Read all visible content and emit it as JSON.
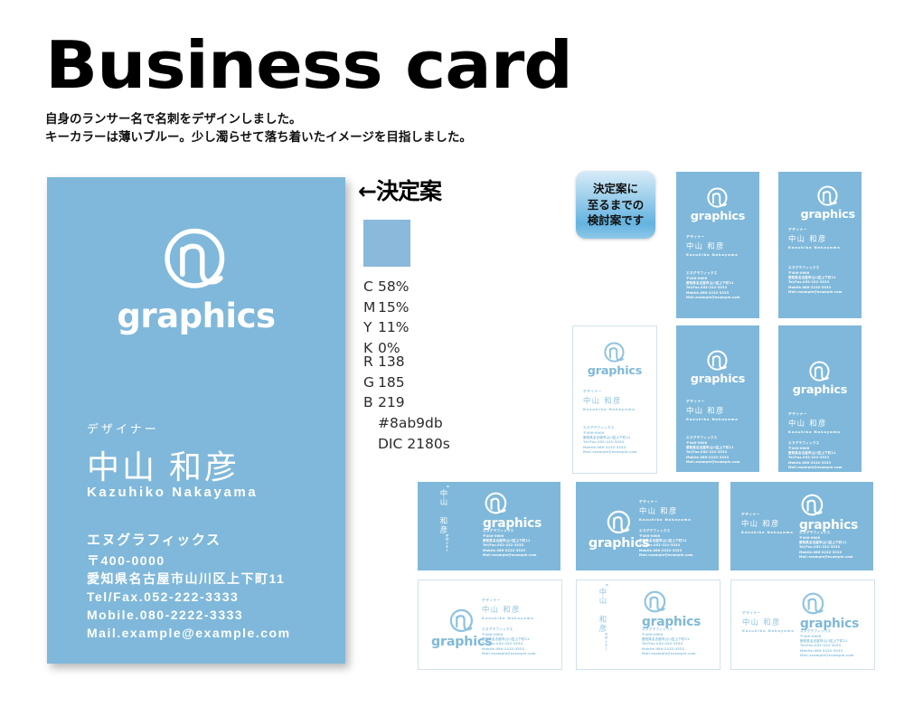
{
  "header": {
    "title": "Business card",
    "subtitle_line1": "自身のランサー名で名刺をデザインしました。",
    "subtitle_line2": "キーカラーは薄いブルー。少し濁らせて落ち着いたイメージを目指しました。"
  },
  "brand": {
    "mark": "circle-n-logo",
    "wordmark": "graphics",
    "key_color": "#8ab9db",
    "card_blue": "#7fb8da",
    "text_blue": "#8fc3de"
  },
  "card": {
    "role": "デザイナー",
    "name": "中山 和彦",
    "romaji": "Kazuhiko Nakayama",
    "company": "エヌグラフィックス",
    "postal": "〒400-0000",
    "address": "愛知県名古屋市山川区上下町11",
    "tel": "Tel/Fax.052-222-3333",
    "mobile": "Mobile.080-2222-3333",
    "mail": "Mail.example@example.com"
  },
  "decision": {
    "heading": "←決定案",
    "arrow_icon": "left-arrow-icon",
    "swatch_color": "#8ab9db",
    "cmyk": [
      {
        "key": "C",
        "value": "58%"
      },
      {
        "key": "M",
        "value": "15%"
      },
      {
        "key": "Y",
        "value": "11%"
      },
      {
        "key": "K",
        "value": "0%"
      }
    ],
    "rgb": [
      {
        "key": "R",
        "value": "138"
      },
      {
        "key": "G",
        "value": "185"
      },
      {
        "key": "B",
        "value": "219"
      },
      {
        "key": "",
        "value": "#8ab9db"
      },
      {
        "key": "",
        "value": "DIC 2180s"
      }
    ]
  },
  "note": {
    "line1": "決定案に",
    "line2": "至るまでの",
    "line3": "検討案です"
  },
  "variants": [
    {
      "id": "v1",
      "orientation": "portrait",
      "bg": "blue",
      "layout": "logo-center-top"
    },
    {
      "id": "v2",
      "orientation": "portrait",
      "bg": "blue",
      "layout": "logo-right-top"
    },
    {
      "id": "v3",
      "orientation": "portrait",
      "bg": "white",
      "layout": "logo-center-top"
    },
    {
      "id": "v4",
      "orientation": "portrait",
      "bg": "blue",
      "layout": "logo-center-upper"
    },
    {
      "id": "v5",
      "orientation": "portrait",
      "bg": "blue",
      "layout": "logo-center-middle"
    },
    {
      "id": "v6",
      "orientation": "landscape",
      "bg": "blue",
      "layout": "vertical-name-left"
    },
    {
      "id": "v7",
      "orientation": "landscape",
      "bg": "blue",
      "layout": "logo-left-text-right"
    },
    {
      "id": "v8",
      "orientation": "landscape",
      "bg": "blue",
      "layout": "name-left-logo-right"
    },
    {
      "id": "v9",
      "orientation": "landscape",
      "bg": "white",
      "layout": "logo-left-text-right"
    },
    {
      "id": "v10",
      "orientation": "landscape",
      "bg": "white",
      "layout": "vertical-name-left"
    },
    {
      "id": "v11",
      "orientation": "landscape",
      "bg": "white",
      "layout": "name-left-logo-right"
    }
  ]
}
